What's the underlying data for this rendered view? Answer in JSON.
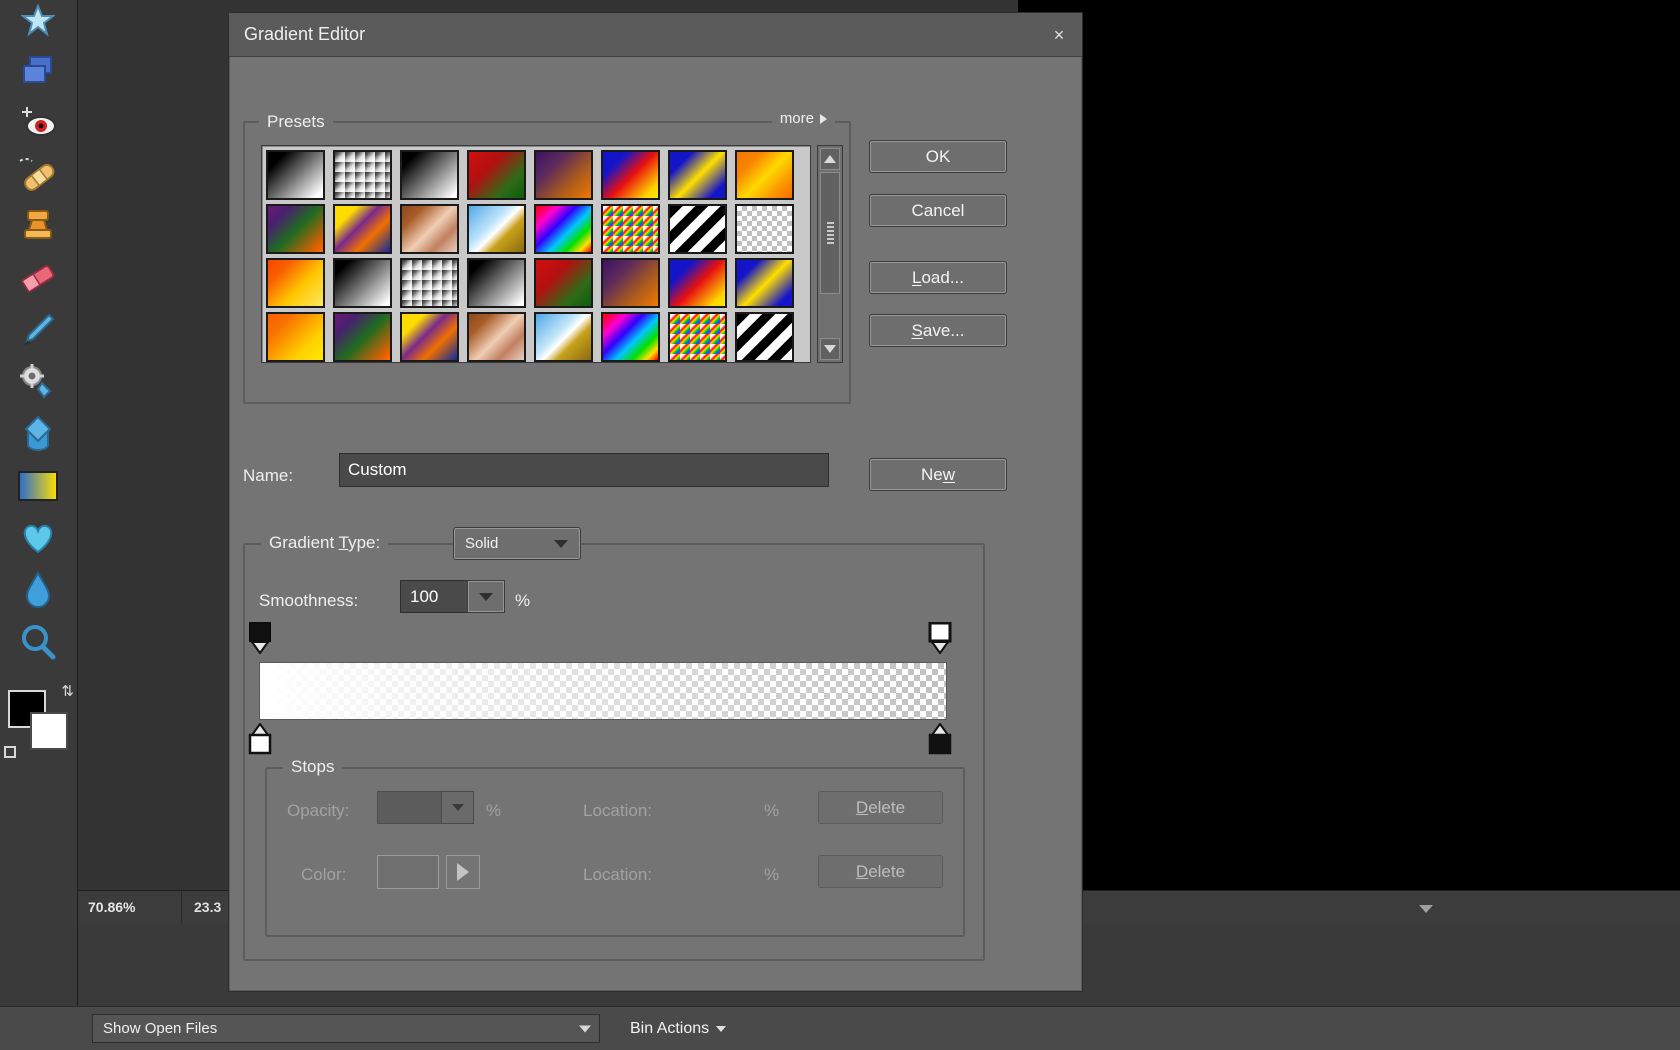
{
  "app": {
    "status_zoom": "70.86%",
    "status_dimensions": "23.3",
    "bin_select_value": "Show Open Files",
    "bin_actions_label": "Bin Actions"
  },
  "dialog": {
    "title": "Gradient Editor",
    "close_label": "×",
    "presets": {
      "legend": "Presets",
      "more_label": "more",
      "swatches": [
        {
          "name": "foreground-to-background",
          "css": "linear-gradient(135deg,#000 0%,#000 18%,#ffffff 92%)"
        },
        {
          "name": "foreground-to-transparent",
          "css": "linear-gradient(135deg,#303030 0%,rgba(60,60,60,0.85) 22%,rgba(120,120,120,0.25) 55%,rgba(255,255,255,0) 85%)",
          "checker": true
        },
        {
          "name": "black-white",
          "css": "linear-gradient(135deg,#000 0%,#000 15%,#ffffff 95%)"
        },
        {
          "name": "red-green",
          "css": "linear-gradient(135deg,#d10f0f 0%,#b31010 35%,#2f6b18 72%,#0d5c10 100%)"
        },
        {
          "name": "violet-orange",
          "css": "linear-gradient(135deg,#3c1160 0%,#5c2a5c 30%,#a85a1e 65%,#f07800 100%)"
        },
        {
          "name": "blue-red-yellow",
          "css": "linear-gradient(135deg,#1414c8 0%,#1414c8 24%,#e81010 52%,#ffd400 86%,#ffe800 100%)"
        },
        {
          "name": "blue-yellow-blue",
          "css": "linear-gradient(135deg,#1414c8 0%,#1414c8 22%,#ffe000 52%,#1414c8 85%,#1414c8 100%)"
        },
        {
          "name": "orange-yellow-orange",
          "css": "linear-gradient(135deg,#f07800 0%,#f88400 24%,#ffd800 52%,#f88400 86%,#f07000 100%)"
        },
        {
          "name": "violet-green-orange",
          "css": "linear-gradient(135deg,#6a1a78 0%,#4a2070 22%,#1f6b20 52%,#f06000 92%,#f87800 100%)"
        },
        {
          "name": "yellow-violet-orange-blue",
          "css": "linear-gradient(135deg,#ffdc00 0%,#ffdc00 22%,#7a2a8a 44%,#f07000 66%,#0f2a9c 100%)"
        },
        {
          "name": "copper",
          "css": "linear-gradient(135deg,#8a4a1c 0%,#a85c28 22%,#f0cdb4 52%,#c08060 74%,#e8cfc0 100%)"
        },
        {
          "name": "chrome",
          "css": "linear-gradient(135deg,#4fa8e8 0%,#bfe4fa 40%,#ffffff 52%,#c8a11a 66%,#8a6a10 100%)"
        },
        {
          "name": "spectrum",
          "css": "linear-gradient(135deg,#ff0000 0%,#ff00d0 22%,#3000ff 40%,#00c8ff 58%,#00e000 74%,#ffe000 88%,#ff0000 100%)"
        },
        {
          "name": "transparent-rainbow",
          "css": "linear-gradient(135deg,rgba(255,255,255,0) 0%,rgba(255,255,255,0) 22%,#ff0000 38%,#ffe000 52%,#00d000 66%,#0060ff 80%,#c000ff 100%)",
          "checker": true
        },
        {
          "name": "transparent-stripes",
          "css": "repeating-linear-gradient(135deg,#000 0px,#000 9px,#ffffff 9px,#ffffff 18px)"
        },
        {
          "name": "transparent-stripes-2",
          "css": "none",
          "checker": true
        },
        {
          "name": "orange-yellow",
          "css": "linear-gradient(135deg,#f84800 0%,#f86000 24%,#ffc800 60%,#ffe860 100%)"
        },
        {
          "name": "black-white-2",
          "css": "linear-gradient(135deg,#000 0%,#000 15%,#ffffff 95%)"
        },
        {
          "name": "foreground-to-transparent-2",
          "css": "linear-gradient(135deg,#303030 0%,rgba(60,60,60,0.85) 22%,rgba(120,120,120,0.25) 55%,rgba(255,255,255,0) 85%)",
          "checker": true
        },
        {
          "name": "black-white-3",
          "css": "linear-gradient(135deg,#000 0%,#000 15%,#ffffff 95%)"
        },
        {
          "name": "red-green-2",
          "css": "linear-gradient(135deg,#d10f0f 0%,#b31010 35%,#2f6b18 72%,#0d5c10 100%)"
        },
        {
          "name": "violet-orange-2",
          "css": "linear-gradient(135deg,#3c1160 0%,#5c2a5c 30%,#a85a1e 65%,#f07800 100%)"
        },
        {
          "name": "blue-red-yellow-2",
          "css": "linear-gradient(135deg,#1414c8 0%,#1414c8 24%,#e81010 52%,#ffd400 86%,#ffe800 100%)"
        },
        {
          "name": "blue-yellow-blue-2",
          "css": "linear-gradient(135deg,#1414c8 0%,#1414c8 22%,#ffe000 52%,#1414c8 85%,#1414c8 100%)"
        },
        {
          "name": "orange-yellow-2",
          "css": "linear-gradient(135deg,#f86000 0%,#f87000 24%,#ffd000 70%,#ffe800 100%)"
        },
        {
          "name": "violet-green-orange-2",
          "css": "linear-gradient(135deg,#6a1a78 0%,#4a2070 22%,#1f6b20 52%,#f06000 92%,#f87800 100%)"
        },
        {
          "name": "yellow-violet-orange-blue-2",
          "css": "linear-gradient(135deg,#ffdc00 0%,#ffdc00 22%,#7a2a8a 44%,#f07000 66%,#0f2a9c 100%)"
        },
        {
          "name": "copper-2",
          "css": "linear-gradient(135deg,#8a4a1c 0%,#a85c28 22%,#f0cdb4 52%,#c08060 74%,#e8cfc0 100%)"
        },
        {
          "name": "chrome-2",
          "css": "linear-gradient(135deg,#4fa8e8 0%,#bfe4fa 40%,#ffffff 52%,#c8a11a 66%,#8a6a10 100%)"
        },
        {
          "name": "spectrum-2",
          "css": "linear-gradient(135deg,#ff0000 0%,#ff00d0 22%,#3000ff 40%,#00c8ff 58%,#00e000 74%,#ffe000 88%,#ff0000 100%)"
        },
        {
          "name": "transparent-rainbow-2",
          "css": "linear-gradient(135deg,rgba(255,255,255,0) 0%,rgba(255,255,255,0) 22%,#ff0000 38%,#ffe000 52%,#00d000 66%,#0060ff 80%,#c000ff 100%)",
          "checker": true
        },
        {
          "name": "transparent-stripes-3",
          "css": "repeating-linear-gradient(135deg,#000 0px,#000 9px,#ffffff 9px,#ffffff 18px)"
        }
      ]
    },
    "buttons": {
      "ok": "OK",
      "cancel": "Cancel",
      "load": "Load...",
      "load_accel": "L",
      "save": "Save...",
      "save_accel": "S",
      "new": "New",
      "new_accel": "w"
    },
    "name": {
      "label": "Name:",
      "value": "Custom"
    },
    "gradient_type": {
      "legend_prefix": "Gradient ",
      "legend_accel": "T",
      "legend_suffix": "ype:",
      "value": "Solid"
    },
    "smoothness": {
      "label": "Smoothness:",
      "value": "100",
      "unit": "%"
    },
    "gradient_bar": {
      "start_color": "#ffffff",
      "end_color": "transparent",
      "opacity_stops": [
        {
          "name": "opacity-stop-left",
          "position": 0,
          "fill": "#000000",
          "selected": false
        },
        {
          "name": "opacity-stop-right",
          "position": 100,
          "fill": "#ffffff",
          "selected": true
        }
      ],
      "color_stops": [
        {
          "name": "color-stop-left",
          "position": 0,
          "fill": "#ffffff"
        },
        {
          "name": "color-stop-right",
          "position": 100,
          "fill": "#000000"
        }
      ]
    },
    "stops": {
      "legend": "Stops",
      "opacity_label": "Opacity:",
      "opacity_value": "",
      "opacity_unit": "%",
      "opacity_location_label": "Location:",
      "opacity_location_value": "",
      "opacity_location_unit": "%",
      "opacity_delete": "Delete",
      "opacity_delete_accel": "D",
      "color_label": "Color:",
      "color_location_label": "Location:",
      "color_location_value": "",
      "color_location_unit": "%",
      "color_delete": "Delete",
      "color_delete_accel": "D"
    }
  },
  "toolbar": {
    "tools": [
      {
        "name": "cookie-cutter-tool",
        "glyph": "star"
      },
      {
        "name": "shape-tool",
        "glyph": "squares"
      },
      {
        "name": "red-eye-removal-tool",
        "glyph": "eye"
      },
      {
        "name": "healing-brush-tool",
        "glyph": "bandage"
      },
      {
        "name": "clone-stamp-tool",
        "glyph": "stamp"
      },
      {
        "name": "eraser-tool",
        "glyph": "eraser"
      },
      {
        "name": "brush-tool",
        "glyph": "brush"
      },
      {
        "name": "smart-brush-tool",
        "glyph": "gear-brush"
      },
      {
        "name": "paint-bucket-tool",
        "glyph": "bucket"
      },
      {
        "name": "gradient-tool",
        "glyph": "gradient"
      },
      {
        "name": "sponge-tool",
        "glyph": "heart"
      },
      {
        "name": "blur-tool",
        "glyph": "droplet"
      },
      {
        "name": "zoom-tool",
        "glyph": "magnifier"
      }
    ],
    "foreground_color": "#000000",
    "background_color": "#ffffff"
  }
}
